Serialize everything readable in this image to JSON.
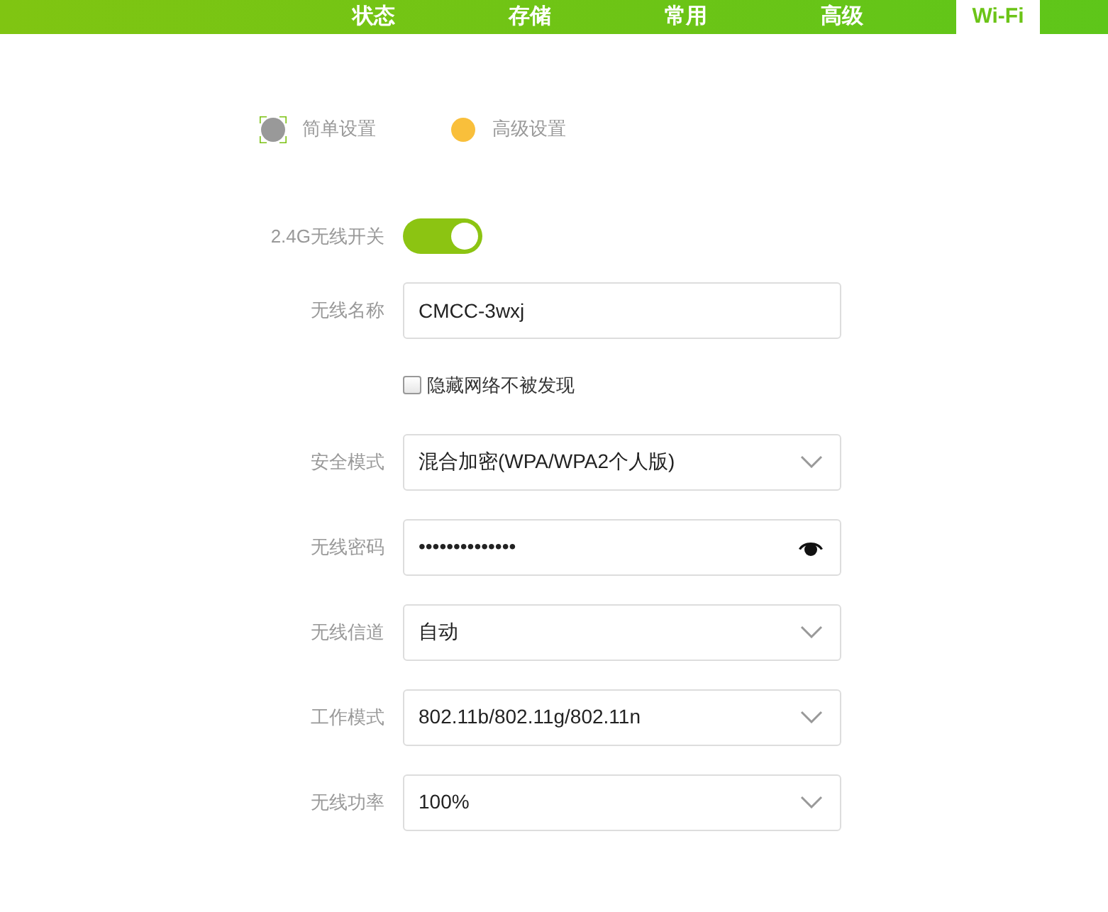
{
  "nav_tabs": [
    {
      "label": "状态",
      "selected": false
    },
    {
      "label": "存储",
      "selected": false
    },
    {
      "label": "常用",
      "selected": false
    },
    {
      "label": "高级",
      "selected": false
    },
    {
      "label": "Wi-Fi",
      "selected": true
    }
  ],
  "setup_modes": [
    {
      "label": "简单设置",
      "selected": false,
      "focused": true
    },
    {
      "label": "高级设置",
      "selected": true,
      "focused": false
    }
  ],
  "form": {
    "rows": [
      {
        "kind": "toggle",
        "label": "2.4G无线开关",
        "on": true
      },
      {
        "kind": "text",
        "label": "无线名称",
        "value": "CMCC-3wxj"
      },
      {
        "kind": "checkbox",
        "text": "隐藏网络不被发现",
        "checked": false
      },
      {
        "kind": "select",
        "label": "安全模式",
        "value": "混合加密(WPA/WPA2个人版)"
      },
      {
        "kind": "password",
        "label": "无线密码",
        "value": "••••••••••••••"
      },
      {
        "kind": "select",
        "label": "无线信道",
        "value": "自动"
      },
      {
        "kind": "select",
        "label": "工作模式",
        "value": "802.11b/802.11g/802.11n"
      },
      {
        "kind": "select",
        "label": "无线功率",
        "value": "100%"
      }
    ]
  }
}
